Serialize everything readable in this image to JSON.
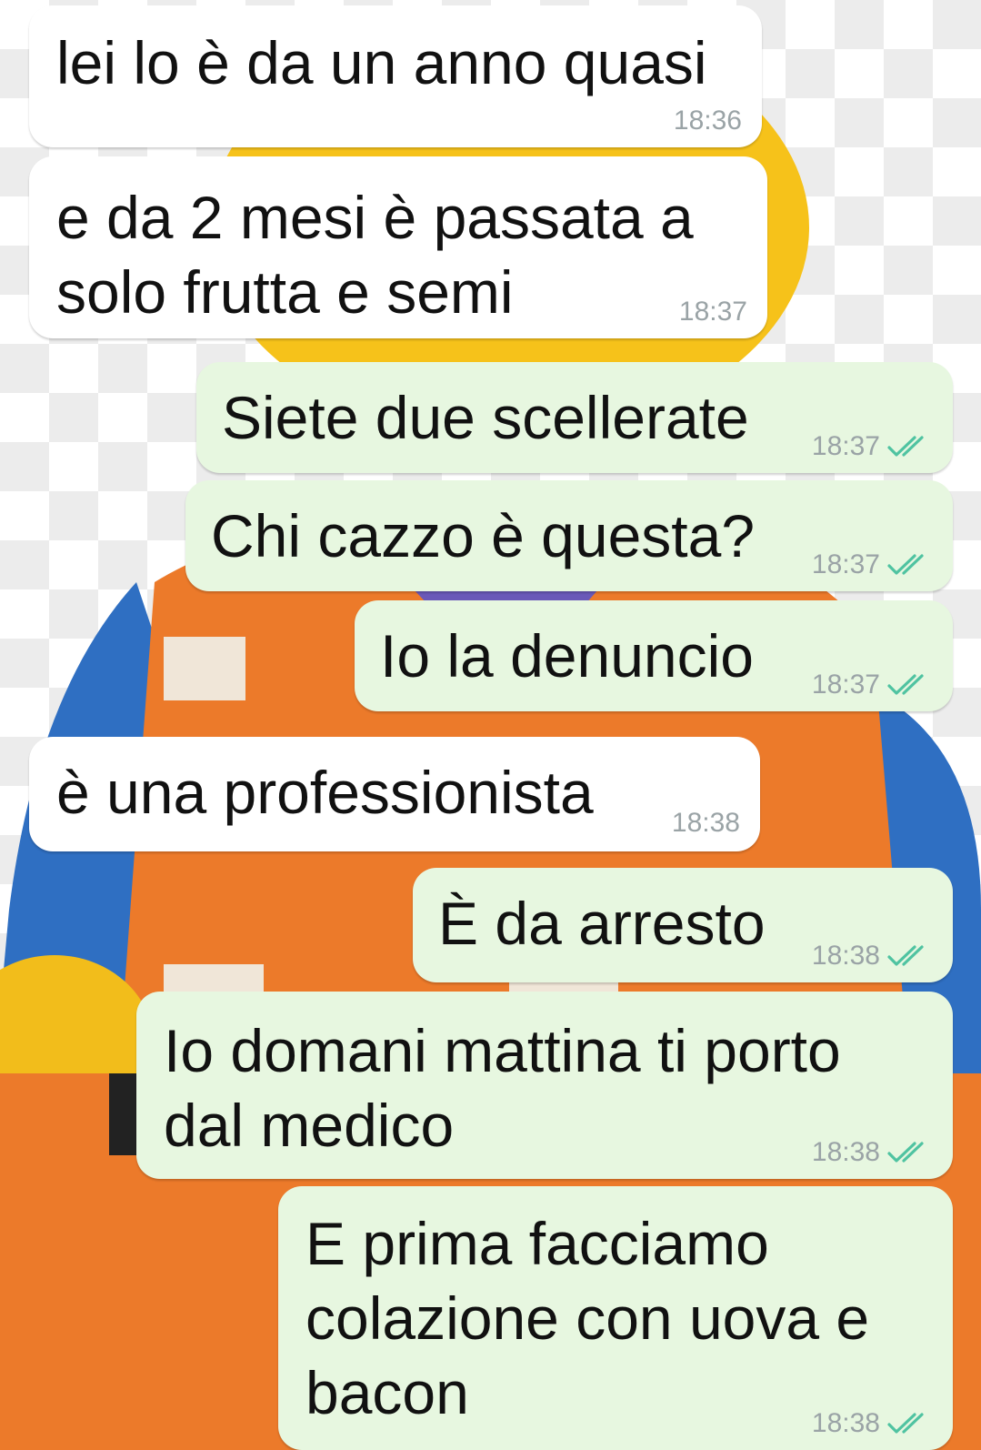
{
  "accent": {
    "incoming_bubble": "#ffffff",
    "outgoing_bubble": "#e7f7e0",
    "read_ticks": "#4fc3a1",
    "timestamp": "#9aa3a6"
  },
  "messages": [
    {
      "direction": "incoming",
      "text": "lei lo è da un anno quasi",
      "time": "18:36"
    },
    {
      "direction": "incoming",
      "text": "e da 2 mesi è passata a\nsolo frutta e semi",
      "time": "18:37"
    },
    {
      "direction": "outgoing",
      "text": "Siete due scellerate",
      "time": "18:37",
      "status_icon": "double-check-icon"
    },
    {
      "direction": "outgoing",
      "text": "Chi cazzo è questa?",
      "time": "18:37",
      "status_icon": "double-check-icon"
    },
    {
      "direction": "outgoing",
      "text": "Io la denuncio",
      "time": "18:37",
      "status_icon": "double-check-icon"
    },
    {
      "direction": "incoming",
      "text": "è una professionista",
      "time": "18:38"
    },
    {
      "direction": "outgoing",
      "text": "È da arresto",
      "time": "18:38",
      "status_icon": "double-check-icon"
    },
    {
      "direction": "outgoing",
      "text": "Io domani mattina ti porto\ndal medico",
      "time": "18:38",
      "status_icon": "double-check-icon"
    },
    {
      "direction": "outgoing",
      "text": "E prima facciamo\ncolazione con uova e\nbacon",
      "time": "18:38",
      "status_icon": "double-check-icon"
    }
  ]
}
